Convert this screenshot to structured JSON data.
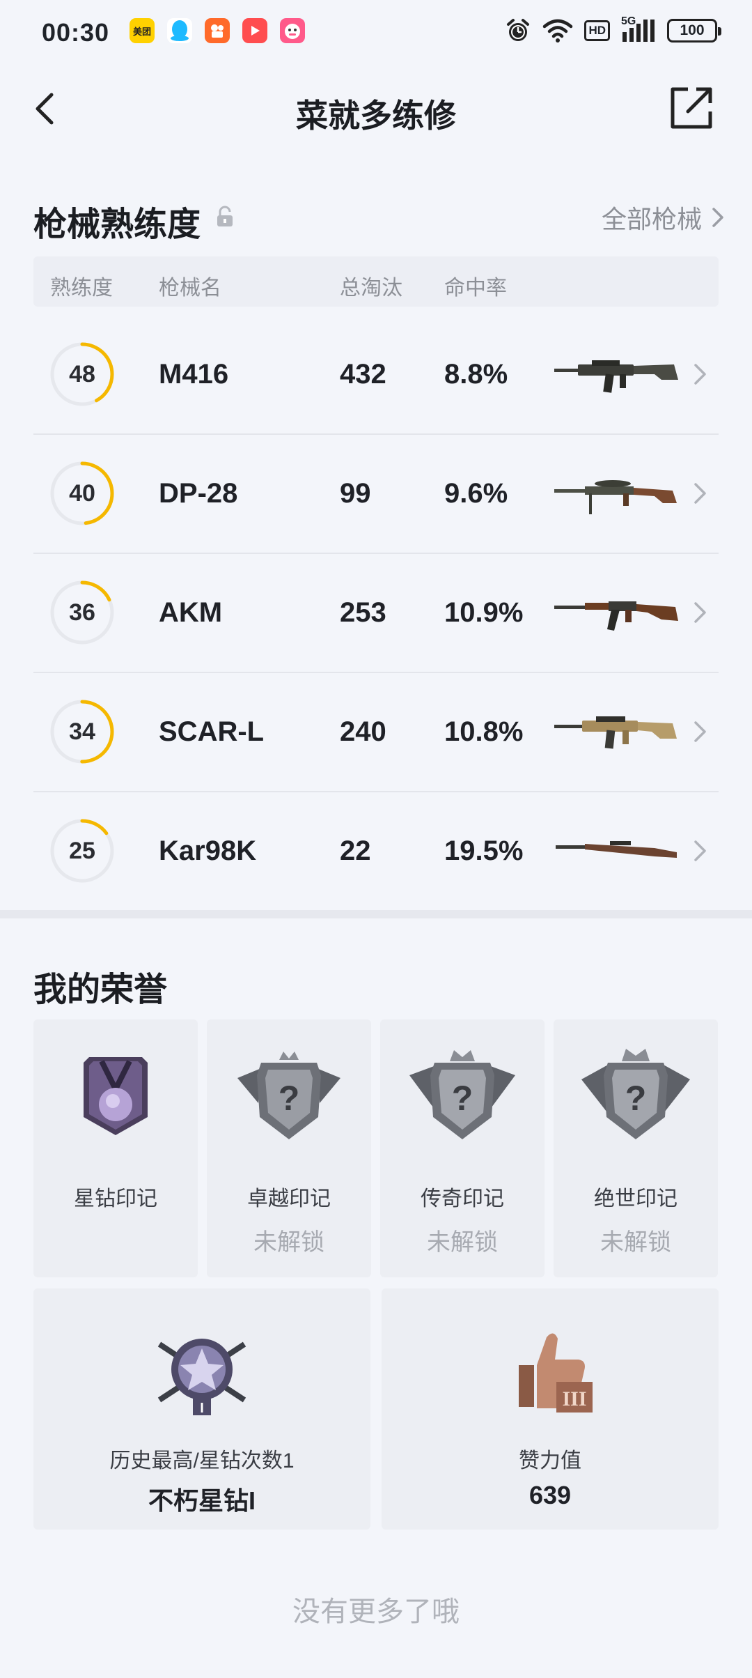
{
  "status_bar": {
    "time": "00:30",
    "apps": [
      {
        "icon": "meituan-app-icon",
        "text": "美团",
        "color": "#ffd100"
      },
      {
        "icon": "qq-app-icon",
        "text": "",
        "color": "#1ebaff"
      },
      {
        "icon": "kuaishou-app-icon",
        "text": "",
        "color": "#ff6a2a"
      },
      {
        "icon": "video-app-icon",
        "text": "",
        "color": "#ff4d4f"
      },
      {
        "icon": "taobao-app-icon",
        "text": "",
        "color": "#ff5a8a"
      }
    ],
    "network": "5G",
    "hd": "HD",
    "battery": "100"
  },
  "header": {
    "title": "菜就多练修"
  },
  "weapon_section": {
    "title": "枪械熟练度",
    "all_link": "全部枪械",
    "columns": {
      "proficiency": "熟练度",
      "name": "枪械名",
      "kills": "总淘汰",
      "hit_rate": "命中率"
    },
    "accent_color": "#f5b800",
    "weapons": [
      {
        "level": "48",
        "name": "M416",
        "kills": "432",
        "hit_rate": "8.8%",
        "progress": 0.42,
        "body_color": "#3c3d38"
      },
      {
        "level": "40",
        "name": "DP-28",
        "kills": "99",
        "hit_rate": "9.6%",
        "progress": 0.48,
        "body_color": "#4c4f45"
      },
      {
        "level": "36",
        "name": "AKM",
        "kills": "253",
        "hit_rate": "10.9%",
        "progress": 0.18,
        "body_color": "#6b3d22"
      },
      {
        "level": "34",
        "name": "SCAR-L",
        "kills": "240",
        "hit_rate": "10.8%",
        "progress": 0.5,
        "body_color": "#a68c5c"
      },
      {
        "level": "25",
        "name": "Kar98K",
        "kills": "22",
        "hit_rate": "19.5%",
        "progress": 0.15,
        "body_color": "#6b4330"
      }
    ]
  },
  "honor_section": {
    "title": "我的荣誉",
    "marks": [
      {
        "name": "星钻印记",
        "status": "",
        "icon": "star-diamond-medal-icon"
      },
      {
        "name": "卓越印记",
        "status": "未解锁",
        "icon": "locked-shield-crest-icon"
      },
      {
        "name": "传奇印记",
        "status": "未解锁",
        "icon": "locked-shield-crest-icon"
      },
      {
        "name": "绝世印记",
        "status": "未解锁",
        "icon": "locked-shield-crest-icon"
      }
    ],
    "highest": {
      "label": "历史最高/星钻次数1",
      "value": "不朽星钻I",
      "icon": "rank-emblem-icon"
    },
    "likes": {
      "label": "赞力值",
      "value": "639",
      "icon": "thumbs-up-trophy-icon"
    }
  },
  "footer": {
    "no_more": "没有更多了哦"
  }
}
